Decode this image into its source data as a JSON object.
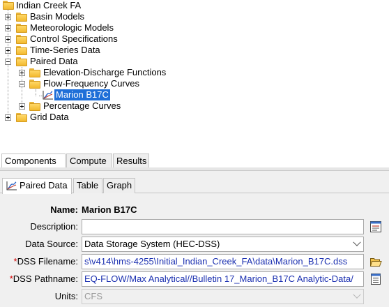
{
  "tree": {
    "root": "Indian Creek FA",
    "basin_models": "Basin Models",
    "meteorologic_models": "Meteorologic Models",
    "control_specifications": "Control Specifications",
    "time_series_data": "Time-Series Data",
    "paired_data": "Paired Data",
    "elevation_discharge": "Elevation-Discharge Functions",
    "flow_frequency": "Flow-Frequency Curves",
    "selected_item": "Marion B17C",
    "percentage_curves": "Percentage Curves",
    "grid_data": "Grid Data"
  },
  "nav_tabs": {
    "components": "Components",
    "compute": "Compute",
    "results": "Results"
  },
  "editor_tabs": {
    "paired_data": "Paired Data",
    "table": "Table",
    "graph": "Graph"
  },
  "form": {
    "name_label": "Name:",
    "name_value": "Marion B17C",
    "description_label": "Description:",
    "description_value": "",
    "data_source_label": "Data Source:",
    "data_source_value": "Data Storage System (HEC-DSS)",
    "required_marker": "*",
    "dss_filename_label": "DSS Filename:",
    "dss_filename_value": "s\\v414\\hms-4255\\Initial_Indian_Creek_FA\\data\\Marion_B17C.dss",
    "dss_pathname_label": "DSS Pathname:",
    "dss_pathname_value": "EQ-FLOW/Max Analytical//Bulletin 17_Marion_B17C Analytic-Data/",
    "units_label": "Units:",
    "units_value": "CFS"
  },
  "colors": {
    "selection": "#1f6fd8",
    "folder": "#f2b92f",
    "path_text": "#1a2fb0",
    "required": "#d40000"
  },
  "icons": {
    "folder": "folder-icon",
    "paired_data_curve": "curve-chart-icon",
    "description_editor": "text-editor-icon",
    "browse_file": "open-folder-icon",
    "select_pathname": "pathname-list-icon"
  }
}
